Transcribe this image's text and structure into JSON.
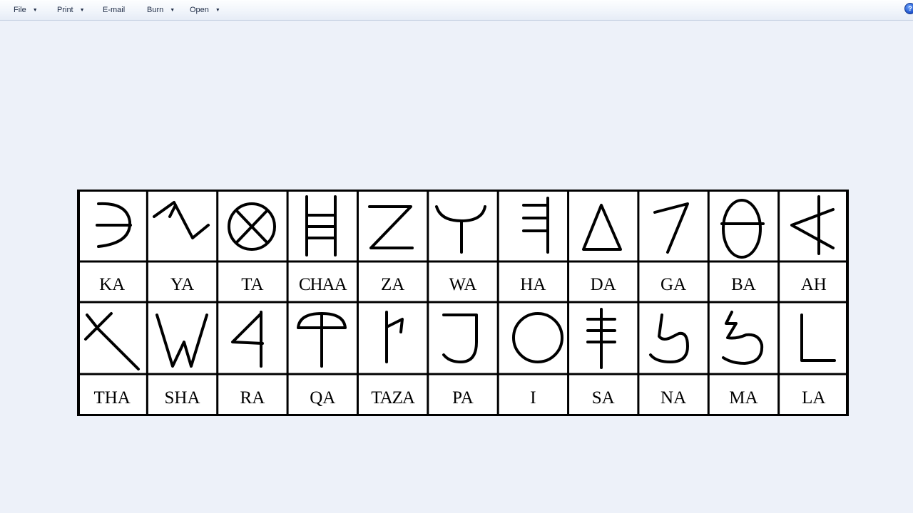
{
  "toolbar": {
    "file_label": "File",
    "print_label": "Print",
    "email_label": "E-mail",
    "burn_label": "Burn",
    "open_label": "Open",
    "help_icon": "help-icon"
  },
  "alphabet_chart": {
    "row1_labels": [
      "KA",
      "YA",
      "TA",
      "CHAA",
      "ZA",
      "WA",
      "HA",
      "DA",
      "GA",
      "BA",
      "AH"
    ],
    "row2_labels": [
      "THA",
      "SHA",
      "RA",
      "QA",
      "TAZA",
      "PA",
      "I",
      "SA",
      "NA",
      "MA",
      "LA"
    ]
  }
}
